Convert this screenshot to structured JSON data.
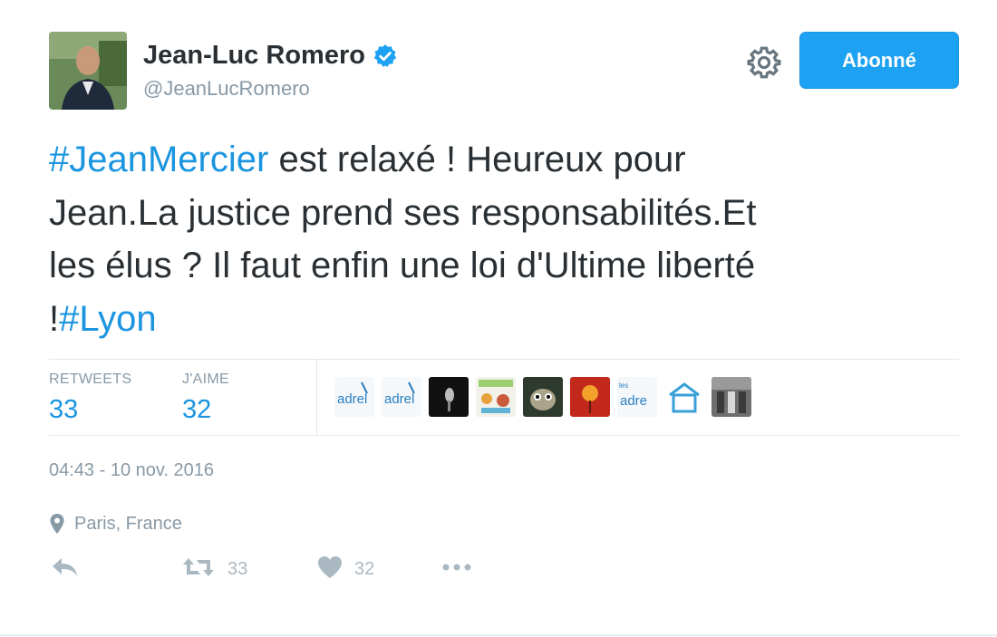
{
  "author": {
    "name": "Jean-Luc Romero",
    "handle": "@JeanLucRomero",
    "verified": true,
    "avatar_icon": "avatar-photo"
  },
  "follow_button": {
    "label": "Abonné",
    "color": "#1da1f2"
  },
  "settings_icon": "gear-icon",
  "tweet": {
    "line1_hashtag": "#JeanMercier",
    "line1_text": " est relaxé ! Heureux pour",
    "line2_text": "Jean.La justice prend ses responsabilités.Et",
    "line3_text": "les élus ? Il faut enfin une loi d'Ultime liberté",
    "line4_prefix": "!",
    "line4_hashtag": "#Lyon",
    "hashtag_color": "#1b95e0"
  },
  "stats": {
    "retweets_label": "RETWEETS",
    "retweets_value": "33",
    "likes_label": "J'AIME",
    "likes_value": "32"
  },
  "likers": [
    {
      "icon": "adrel-logo-avatar"
    },
    {
      "icon": "adrel-logo-avatar"
    },
    {
      "icon": "dark-photo-avatar"
    },
    {
      "icon": "colorful-illustration-avatar"
    },
    {
      "icon": "cartoon-dog-avatar"
    },
    {
      "icon": "red-flower-avatar"
    },
    {
      "icon": "adrel-logo-avatar"
    },
    {
      "icon": "house-logo-avatar"
    },
    {
      "icon": "building-photo-avatar"
    }
  ],
  "timestamp": "04:43 - 10 nov. 2016",
  "location": {
    "icon": "location-pin-icon",
    "text": "Paris, France"
  },
  "actions": {
    "reply_icon": "reply-icon",
    "retweet_icon": "retweet-icon",
    "retweet_count": "33",
    "like_icon": "heart-icon",
    "like_count": "32",
    "more_icon": "more-dots-icon"
  }
}
